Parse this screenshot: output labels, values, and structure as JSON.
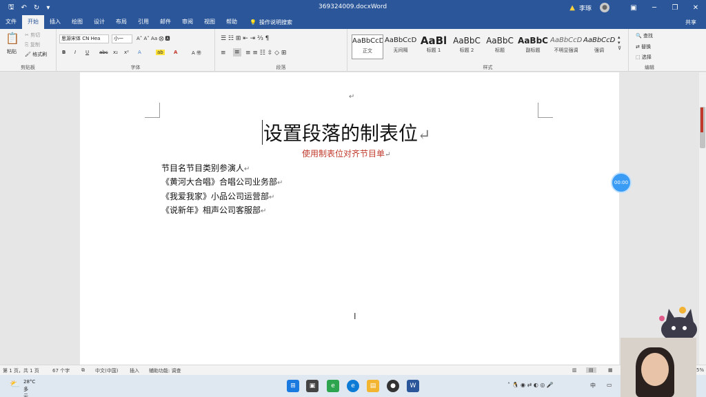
{
  "titlebar": {
    "doc_name": "369324009.docx",
    "app_name": "Word",
    "user_name": "李琢",
    "qat": [
      "save",
      "undo",
      "redo",
      "customize"
    ]
  },
  "tabs": [
    "文件",
    "开始",
    "插入",
    "绘图",
    "设计",
    "布局",
    "引用",
    "邮件",
    "审阅",
    "视图",
    "帮助"
  ],
  "active_tab": "开始",
  "tell_me": "操作说明搜索",
  "share": "共享",
  "ribbon": {
    "clipboard": {
      "label": "剪贴板",
      "paste": "粘贴",
      "cut": "剪切",
      "copy": "复制",
      "format_painter": "格式刷"
    },
    "font": {
      "label": "字体",
      "font_name": "思源宋体 CN Hea",
      "font_size": "小一",
      "bold": "B",
      "italic": "I",
      "underline": "U",
      "strike": "abc",
      "sub": "x₂",
      "sup": "x²"
    },
    "paragraph": {
      "label": "段落"
    },
    "styles": {
      "label": "样式",
      "items": [
        {
          "preview": "AaBbCcDc",
          "name": "正文"
        },
        {
          "preview": "AaBbCcDc",
          "name": "无间隔"
        },
        {
          "preview": "AaBl",
          "name": "标题 1"
        },
        {
          "preview": "AaBbC",
          "name": "标题 2"
        },
        {
          "preview": "AaBbC",
          "name": "标题"
        },
        {
          "preview": "AaBbC",
          "name": "副标题"
        },
        {
          "preview": "AaBbCcD",
          "name": "不明显强调"
        },
        {
          "preview": "AaBbCcD",
          "name": "强调"
        }
      ]
    },
    "editing": {
      "label": "编辑",
      "find": "查找",
      "replace": "替换",
      "select": "选择"
    }
  },
  "document": {
    "top_mark": "↵",
    "heading": "设置段落的制表位",
    "subheading": "使用制表位对齐节目单",
    "para_mark": "↵",
    "lines": [
      "节目名节目类别参演人",
      "《黄河大合唱》合唱公司业务部",
      "《我爱我家》小品公司运营部",
      "《说新年》相声公司客服部"
    ],
    "timer": "00:00"
  },
  "status": {
    "page": "第 1 页，共 1 页",
    "words": "67 个字",
    "lang": "中文(中国)",
    "mode": "插入",
    "accessibility": "辅助功能: 调查",
    "zoom": "5%"
  },
  "taskbar": {
    "temp": "28°C",
    "weather": "多云",
    "ime": "中"
  },
  "colors": {
    "brand": "#2b579a",
    "accent_red": "#c0392b",
    "timer": "#3a9cf5"
  }
}
